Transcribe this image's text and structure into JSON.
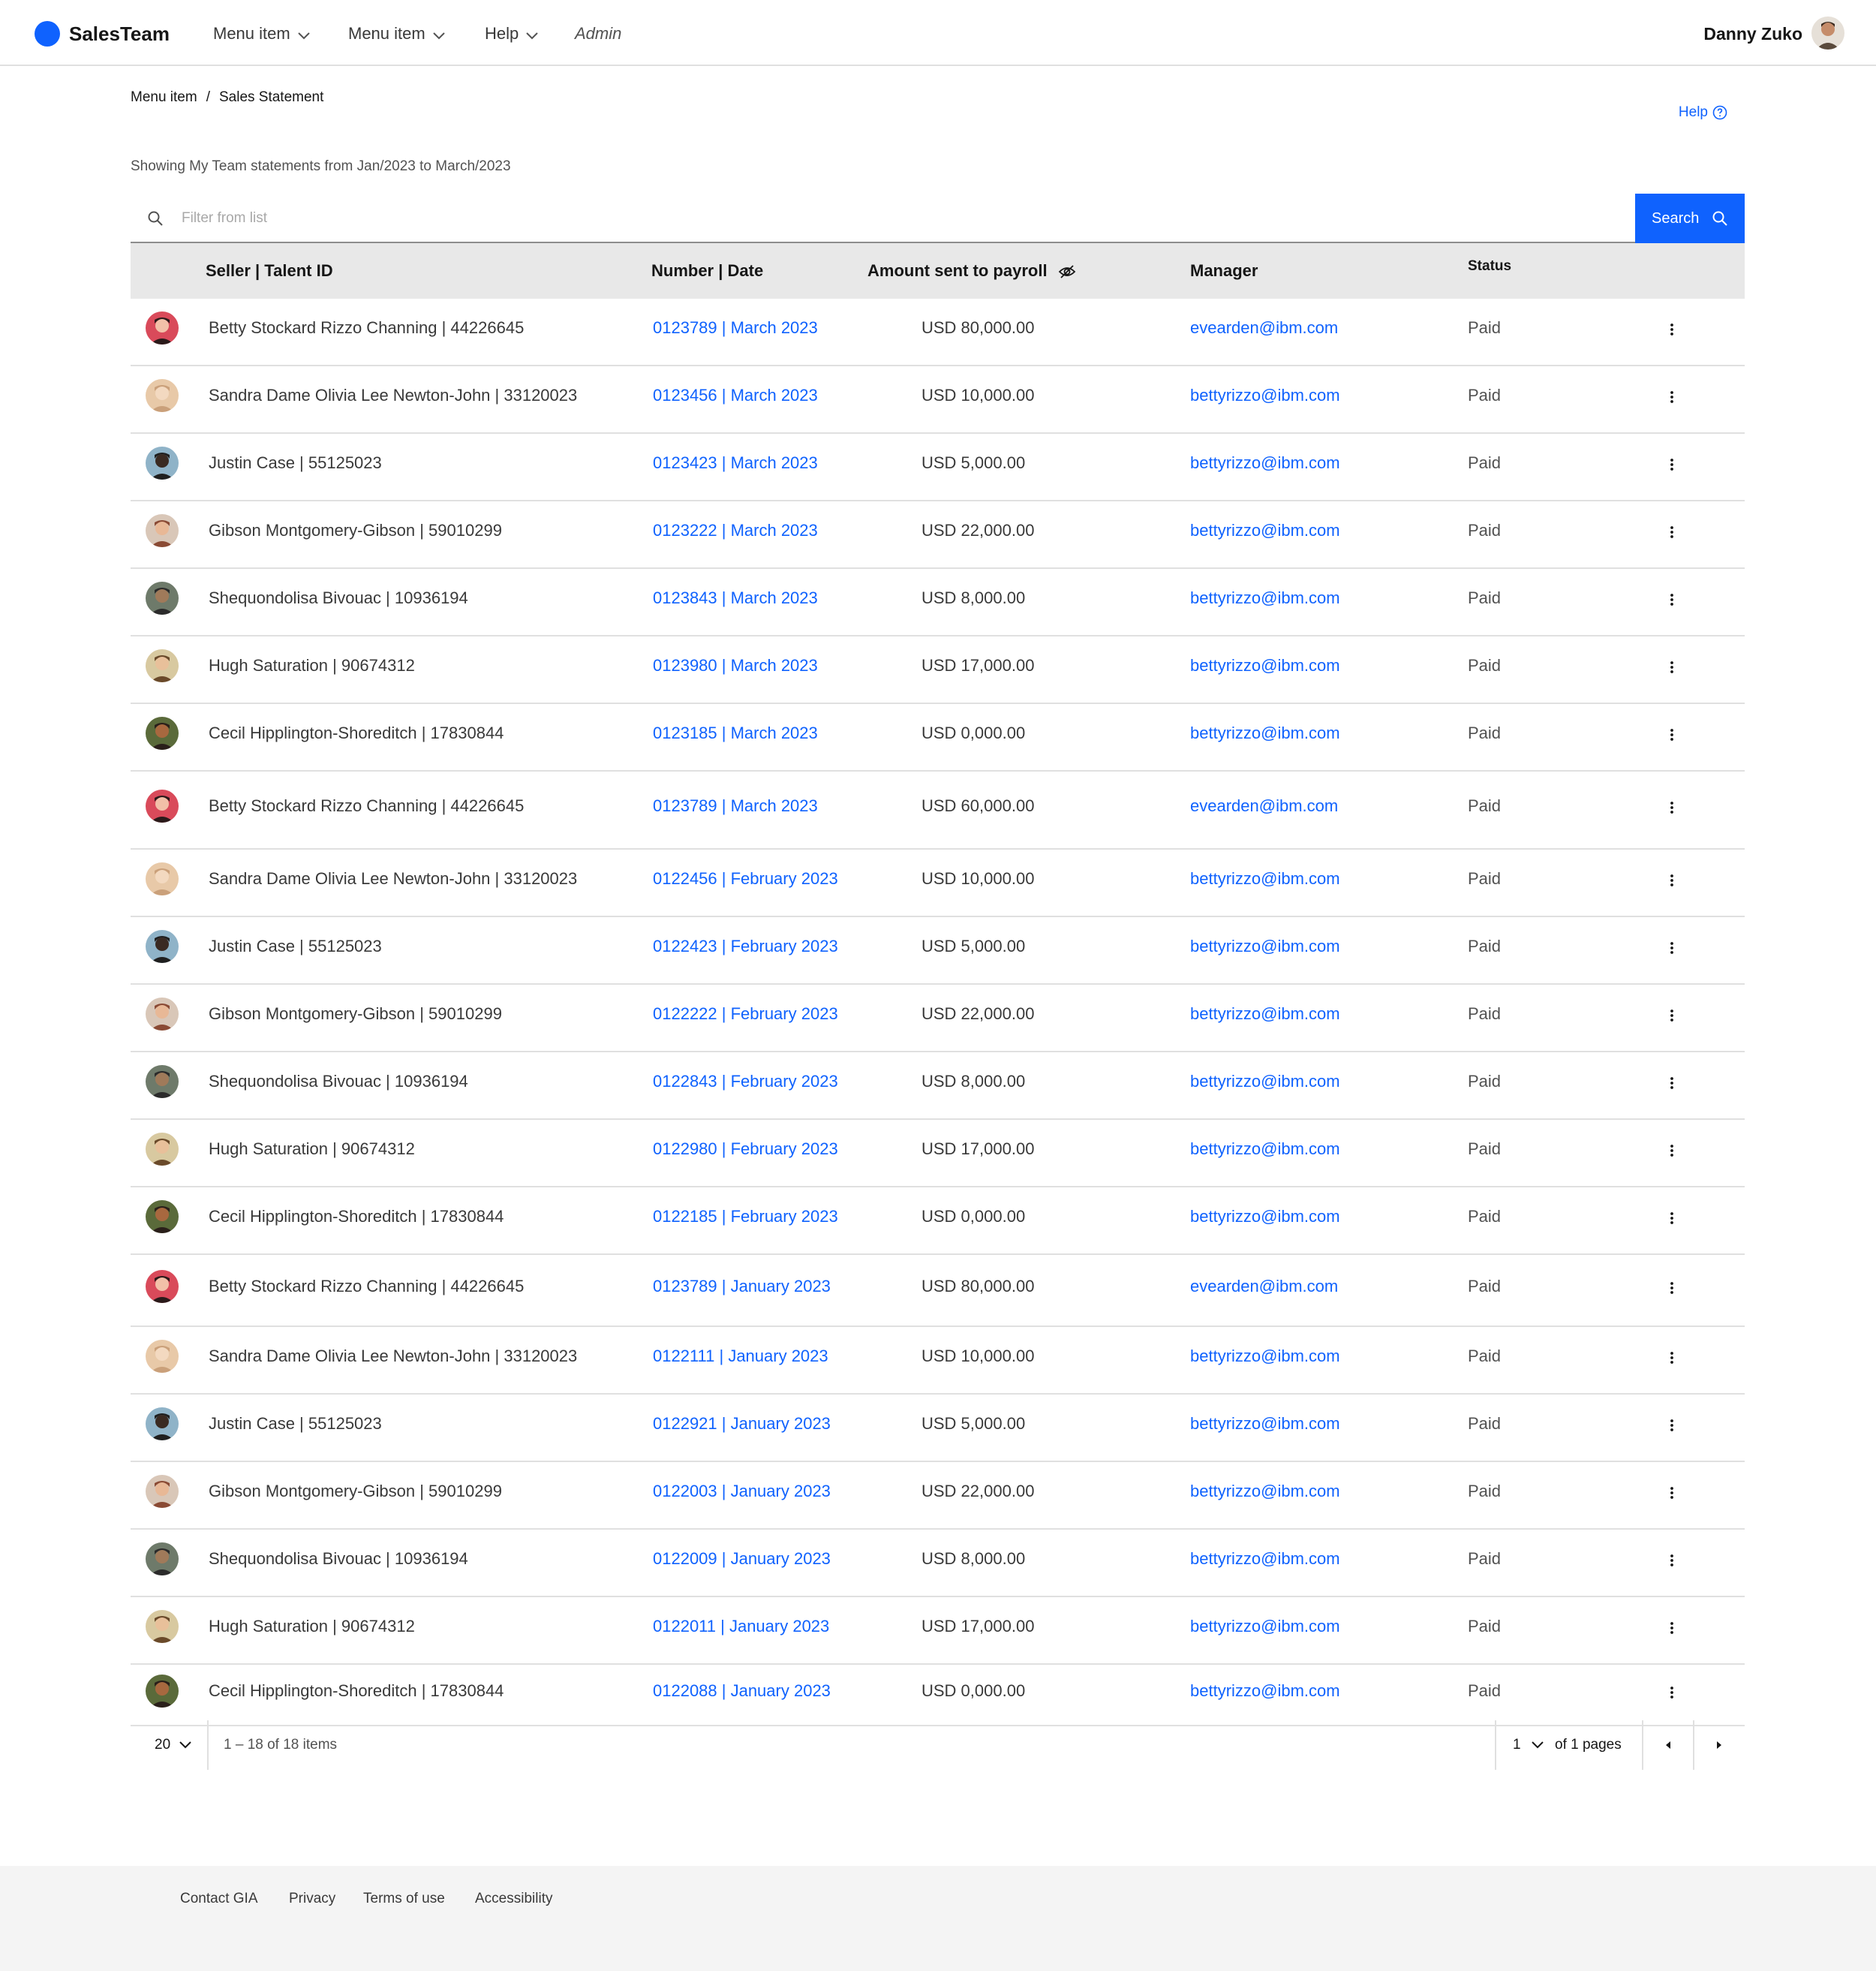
{
  "header": {
    "app_name": "SalesTeam",
    "nav": [
      {
        "label": "Menu item",
        "has_chevron": true
      },
      {
        "label": "Menu item",
        "has_chevron": true
      },
      {
        "label": "Help",
        "has_chevron": true
      },
      {
        "label": "Admin",
        "has_chevron": false
      }
    ],
    "user_name": "Danny Zuko"
  },
  "breadcrumb": {
    "items": [
      "Menu item",
      "Sales Statement"
    ],
    "separator": "/"
  },
  "help_link": {
    "label": "Help",
    "icon": "help-circle-icon"
  },
  "showing_text": "Showing My Team statements from Jan/2023 to March/2023",
  "search": {
    "placeholder": "Filter from list",
    "value": "",
    "button_label": "Search"
  },
  "table": {
    "columns": {
      "seller": "Seller | Talent ID",
      "number": "Number | Date",
      "amount": "Amount sent to payroll",
      "amount_icon": "view-off-icon",
      "manager": "Manager",
      "status": "Status"
    },
    "rows": [
      {
        "seller": "Betty Stockard Rizzo Channing | 44226645",
        "number": "0123789 | March 2023",
        "amount": "USD 80,000.00",
        "manager": "evearden@ibm.com",
        "status": "Paid"
      },
      {
        "seller": "Sandra Dame Olivia Lee Newton-John | 33120023",
        "number": "0123456 | March 2023",
        "amount": "USD 10,000.00",
        "manager": "bettyrizzo@ibm.com",
        "status": "Paid"
      },
      {
        "seller": "Justin Case | 55125023",
        "number": "0123423 | March 2023",
        "amount": "USD 5,000.00",
        "manager": "bettyrizzo@ibm.com",
        "status": "Paid"
      },
      {
        "seller": "Gibson Montgomery-Gibson | 59010299",
        "number": "0123222 | March 2023",
        "amount": "USD 22,000.00",
        "manager": "bettyrizzo@ibm.com",
        "status": "Paid"
      },
      {
        "seller": "Shequondolisa Bivouac | 10936194",
        "number": "0123843 | March 2023",
        "amount": "USD 8,000.00",
        "manager": "bettyrizzo@ibm.com",
        "status": "Paid"
      },
      {
        "seller": "Hugh Saturation | 90674312",
        "number": "0123980 | March 2023",
        "amount": "USD 17,000.00",
        "manager": "bettyrizzo@ibm.com",
        "status": "Paid"
      },
      {
        "seller": "Cecil Hipplington-Shoreditch | 17830844",
        "number": "0123185 | March 2023",
        "amount": "USD 0,000.00",
        "manager": "bettyrizzo@ibm.com",
        "status": "Paid"
      },
      {
        "seller": "Betty Stockard Rizzo Channing | 44226645",
        "number": "0123789 | March 2023",
        "amount": "USD 60,000.00",
        "manager": "evearden@ibm.com",
        "status": "Paid"
      },
      {
        "seller": "Sandra Dame Olivia Lee Newton-John | 33120023",
        "number": "0122456 | February 2023",
        "amount": "USD 10,000.00",
        "manager": "bettyrizzo@ibm.com",
        "status": "Paid"
      },
      {
        "seller": "Justin Case | 55125023",
        "number": "0122423 | February 2023",
        "amount": "USD 5,000.00",
        "manager": "bettyrizzo@ibm.com",
        "status": "Paid"
      },
      {
        "seller": "Gibson Montgomery-Gibson | 59010299",
        "number": "0122222 | February 2023",
        "amount": "USD 22,000.00",
        "manager": "bettyrizzo@ibm.com",
        "status": "Paid"
      },
      {
        "seller": "Shequondolisa Bivouac | 10936194",
        "number": "0122843 | February 2023",
        "amount": "USD 8,000.00",
        "manager": "bettyrizzo@ibm.com",
        "status": "Paid"
      },
      {
        "seller": "Hugh Saturation | 90674312",
        "number": "0122980 | February 2023",
        "amount": "USD 17,000.00",
        "manager": "bettyrizzo@ibm.com",
        "status": "Paid"
      },
      {
        "seller": "Cecil Hipplington-Shoreditch | 17830844",
        "number": "0122185 | February 2023",
        "amount": "USD 0,000.00",
        "manager": "bettyrizzo@ibm.com",
        "status": "Paid"
      },
      {
        "seller": "Betty Stockard Rizzo Channing | 44226645",
        "number": "0123789 | January 2023",
        "amount": "USD 80,000.00",
        "manager": "evearden@ibm.com",
        "status": "Paid"
      },
      {
        "seller": "Sandra Dame Olivia Lee Newton-John | 33120023",
        "number": "0122111 | January 2023",
        "amount": "USD 10,000.00",
        "manager": "bettyrizzo@ibm.com",
        "status": "Paid"
      },
      {
        "seller": "Justin Case | 55125023",
        "number": "0122921 | January 2023",
        "amount": "USD 5,000.00",
        "manager": "bettyrizzo@ibm.com",
        "status": "Paid"
      },
      {
        "seller": "Gibson Montgomery-Gibson | 59010299",
        "number": "0122003 | January 2023",
        "amount": "USD 22,000.00",
        "manager": "bettyrizzo@ibm.com",
        "status": "Paid"
      },
      {
        "seller": "Shequondolisa Bivouac | 10936194",
        "number": "0122009 | January 2023",
        "amount": "USD 8,000.00",
        "manager": "bettyrizzo@ibm.com",
        "status": "Paid"
      },
      {
        "seller": "Hugh Saturation | 90674312",
        "number": "0122011 | January 2023",
        "amount": "USD 17,000.00",
        "manager": "bettyrizzo@ibm.com",
        "status": "Paid"
      },
      {
        "seller": "Cecil Hipplington-Shoreditch | 17830844",
        "number": "0122088 | January 2023",
        "amount": "USD 0,000.00",
        "manager": "bettyrizzo@ibm.com",
        "status": "Paid"
      }
    ]
  },
  "pagination": {
    "page_size": "20",
    "range_text": "1 – 18 of 18 items",
    "current_page": "1",
    "of_pages_text": "of 1 pages"
  },
  "footer": {
    "links": [
      "Contact GIA",
      "Privacy",
      "Terms of use",
      "Accessibility"
    ]
  },
  "colors": {
    "accent": "#0f62fe",
    "header_bg": "#e8e8e8",
    "footer_bg": "#f4f4f4"
  }
}
